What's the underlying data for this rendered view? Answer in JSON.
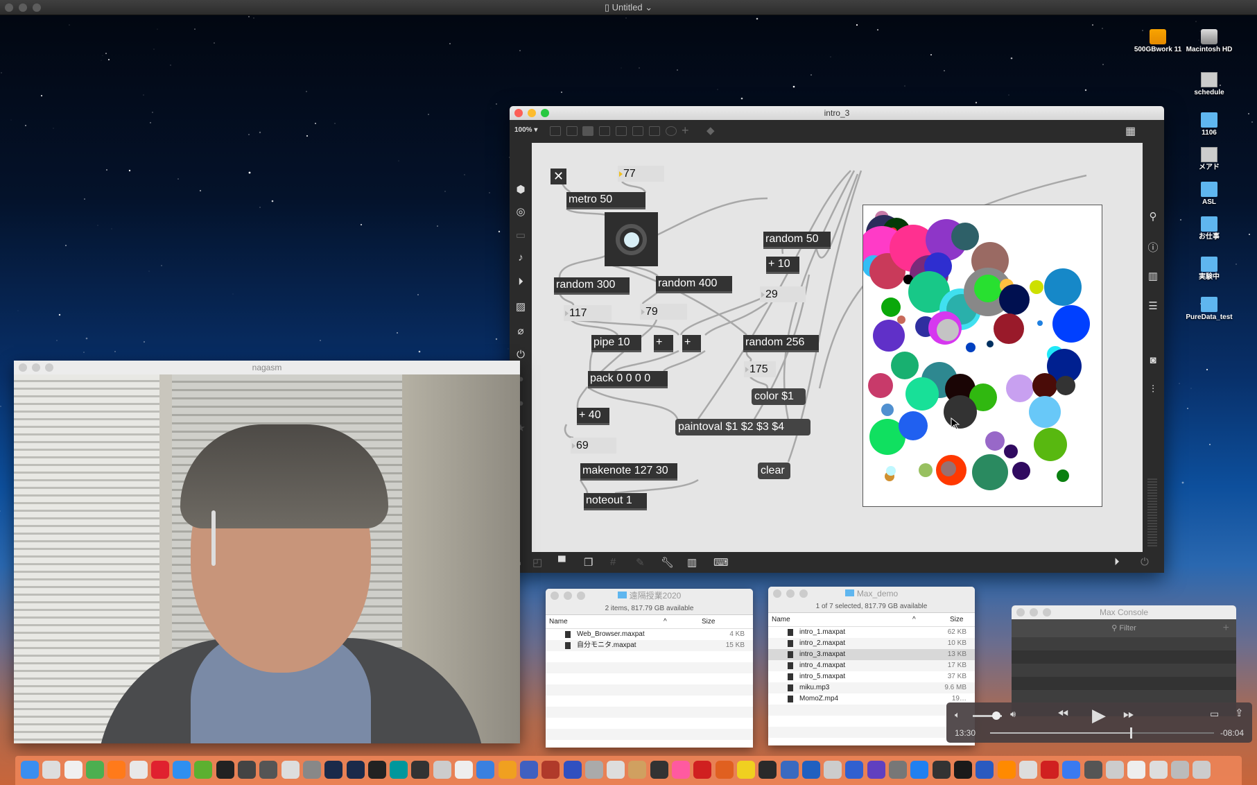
{
  "menubar": {
    "title": "Untitled"
  },
  "desktop_icons": [
    {
      "label": "500GBwork 11",
      "icon": "external-drive-icon"
    },
    {
      "label": "Macintosh HD",
      "icon": "hard-drive-icon"
    },
    {
      "label": "schedule",
      "icon": "document-icon"
    },
    {
      "label": "1106",
      "icon": "folder-icon"
    },
    {
      "label": "メアド",
      "icon": "document-icon"
    },
    {
      "label": "ASL",
      "icon": "folder-icon"
    },
    {
      "label": "お仕事",
      "icon": "folder-icon"
    },
    {
      "label": "実験中",
      "icon": "folder-icon"
    },
    {
      "label": "PureData_test",
      "icon": "folder-icon"
    }
  ],
  "max_window": {
    "title": "intro_3",
    "zoom": "100% ▾",
    "objects": {
      "toggle": "✕",
      "num_77": "77",
      "metro": "metro 50",
      "random300": "random 300",
      "random400": "random 400",
      "random50": "random 50",
      "plus10": "+ 10",
      "num_29": "29",
      "num_117": "117",
      "num_79": "79",
      "pipe": "pipe 10",
      "plus_a": "+",
      "plus_b": "+",
      "random256": "random 256",
      "num_175": "175",
      "pack": "pack 0 0 0 0",
      "color": "color $1",
      "plus40": "+ 40",
      "paintoval": "paintoval $1 $2 $3 $4",
      "num_69": "69",
      "makenote": "makenote 127 30",
      "clear": "clear",
      "noteout": "noteout 1"
    }
  },
  "camera_window": {
    "title": "nagasm"
  },
  "finder_1": {
    "title": "遠隔授業2020",
    "status": "2 items, 817.79 GB available",
    "col_name": "Name",
    "col_size": "Size",
    "files": [
      {
        "name": "Web_Browser.maxpat",
        "size": "4 KB"
      },
      {
        "name": "自分モニタ.maxpat",
        "size": "15 KB"
      }
    ]
  },
  "finder_2": {
    "title": "Max_demo",
    "status": "1 of 7 selected, 817.79 GB available",
    "col_name": "Name",
    "col_size": "Size",
    "files": [
      {
        "name": "intro_1.maxpat",
        "size": "62 KB"
      },
      {
        "name": "intro_2.maxpat",
        "size": "10 KB"
      },
      {
        "name": "intro_3.maxpat",
        "size": "13 KB",
        "selected": true
      },
      {
        "name": "intro_4.maxpat",
        "size": "17 KB"
      },
      {
        "name": "intro_5.maxpat",
        "size": "37 KB"
      },
      {
        "name": "miku.mp3",
        "size": "9.6 MB"
      },
      {
        "name": "MomoZ.mp4",
        "size": "19…"
      }
    ]
  },
  "console": {
    "title": "Max Console",
    "filter_placeholder": "Filter",
    "add": "+"
  },
  "player": {
    "elapsed": "13:30",
    "remaining": "-08:04",
    "progress": 0.626,
    "volume": 0.8
  }
}
